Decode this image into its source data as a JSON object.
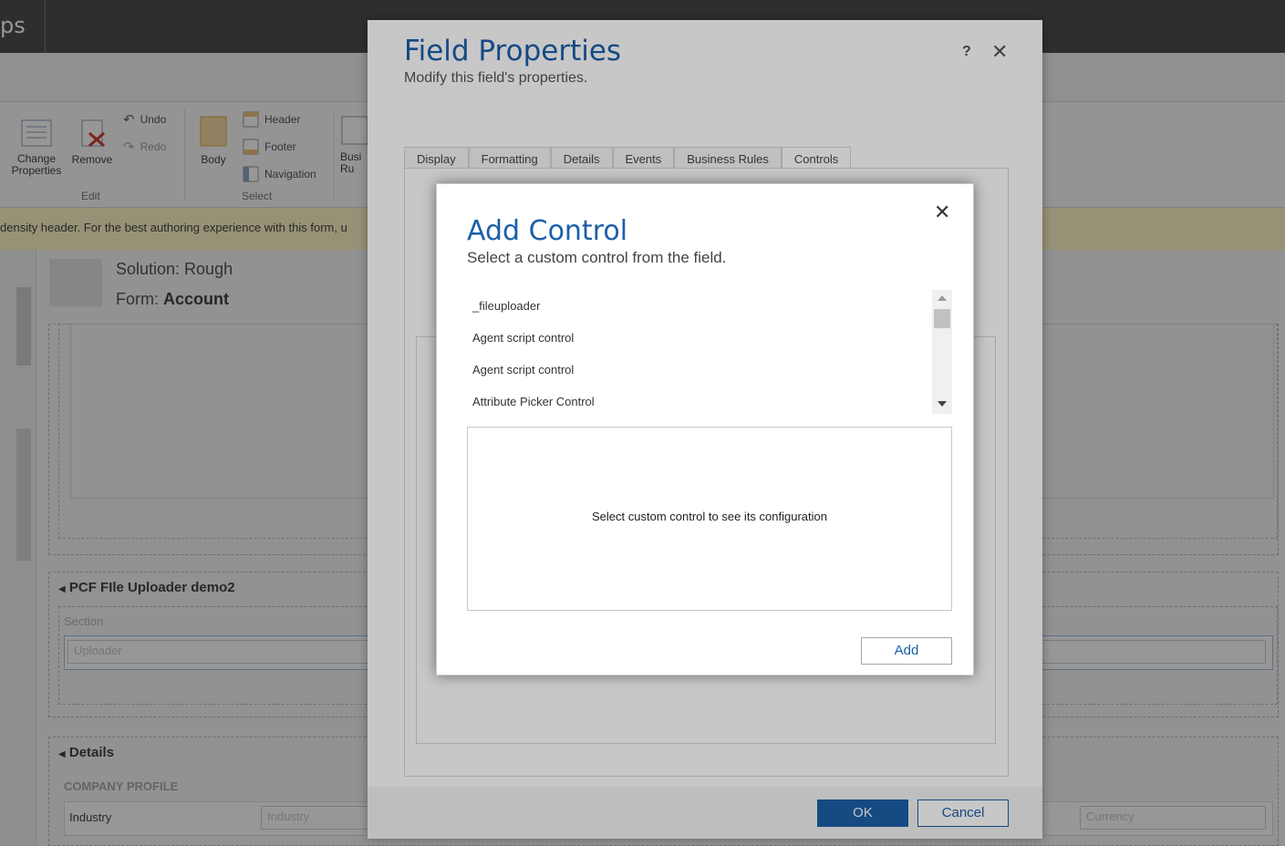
{
  "app": {
    "title_fragment": "ps"
  },
  "ribbon": {
    "change_properties": "Change Properties",
    "remove": "Remove",
    "undo": "Undo",
    "redo": "Redo",
    "edit_group": "Edit",
    "body": "Body",
    "header": "Header",
    "footer": "Footer",
    "navigation": "Navigation",
    "select_group": "Select",
    "business_rules_fragment": "Busi Ru"
  },
  "warning": {
    "text": "density header. For the best authoring experience with this form, u"
  },
  "form": {
    "solution_label": "Solution: Rough",
    "form_label": "Form:",
    "form_name": "Account",
    "sections": [
      {
        "title": "PCF FIle Uploader demo2",
        "sub": "Section",
        "field_placeholder": "Uploader"
      },
      {
        "title": "Details",
        "sub": "COMPANY PROFILE",
        "field_label": "Industry",
        "field_placeholder": "Industry",
        "field_placeholder_right": "Currency"
      }
    ]
  },
  "field_properties": {
    "title": "Field Properties",
    "subtitle": "Modify this field's properties.",
    "help": "?",
    "close": "✕",
    "tabs": [
      "Display",
      "Formatting",
      "Details",
      "Events",
      "Business Rules",
      "Controls"
    ],
    "active_tab": "Controls",
    "ok": "OK",
    "cancel": "Cancel"
  },
  "add_control": {
    "title": "Add Control",
    "subtitle": "Select a custom control from the field.",
    "close": "✕",
    "controls": [
      "_fileuploader",
      "Agent script control",
      "Agent script control",
      "Attribute Picker Control"
    ],
    "config_placeholder": "Select custom control to see its configuration",
    "add": "Add"
  },
  "colors": {
    "accent": "#1b5fa8",
    "topbar": "#505050",
    "warning": "#fff7c8"
  }
}
